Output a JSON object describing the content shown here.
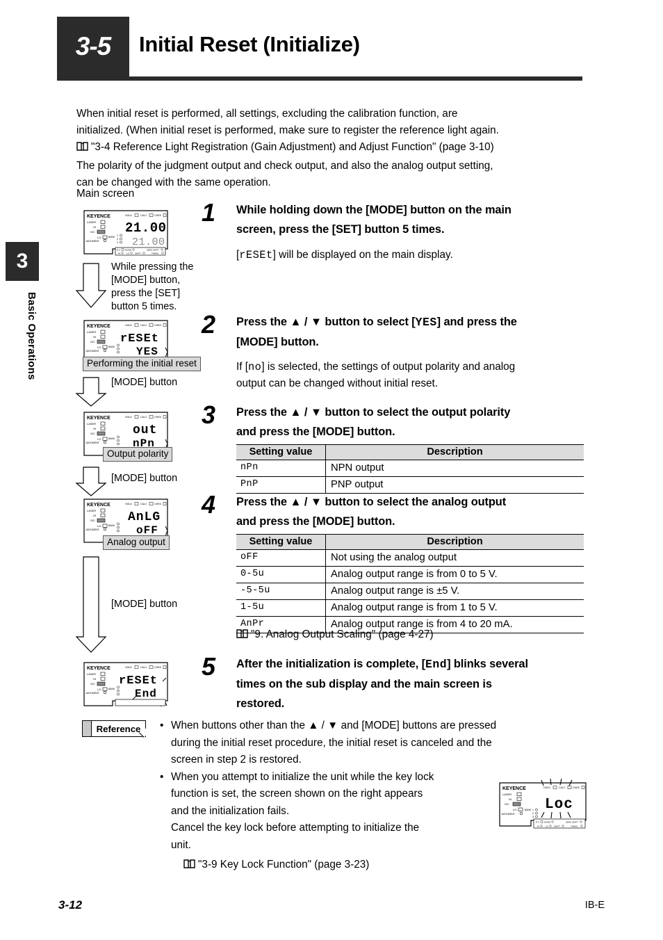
{
  "chapter": {
    "number": "3",
    "label": "Basic Operations"
  },
  "header": {
    "section_number": "3-5",
    "title": "Initial Reset (Initialize)"
  },
  "intro": {
    "line1": "When initial reset is performed, all settings, excluding the calibration function, are",
    "line2": "initialized. (When initial reset is performed, make sure to register the reference light again.",
    "ref_line": "\"3-4 Reference Light Registration (Gain Adjustment) and Adjust Function\" (page 3-10)",
    "line3": "The polarity of the judgment output and check output, and also the analog output setting,",
    "line4": "can be changed with the same operation.",
    "main_screen_label": "Main screen"
  },
  "flow": {
    "device_brand": "KEYENCE",
    "note1_l1": "While pressing the",
    "note1_l2": "[MODE] button,",
    "note1_l3": "press the [SET]",
    "note1_l4": "button 5 times.",
    "mode_button_1": "[MODE] button",
    "mode_button_2": "[MODE] button",
    "mode_button_3": "[MODE] button",
    "callout_reset": "Performing the initial reset",
    "callout_polarity": "Output polarity",
    "callout_analog": "Analog output",
    "display_main_top": "21.00",
    "display_main_bottom": "21.00",
    "display_reset_top": "rESEt",
    "display_reset_bottom": "YES",
    "display_out_top": "out",
    "display_out_bottom": "nPn",
    "display_anlg_top": "AnLG",
    "display_anlg_bottom": "oFF",
    "display_end_top": "rESEt",
    "display_end_bottom": "End",
    "display_loc": "Loc",
    "ind_hold": "HOLD",
    "ind_calc": "CALC",
    "ind_chek": "CHEK",
    "ind_laser": "LASER",
    "ind_hi": "HI",
    "ind_go": "GO",
    "ind_lo": "LO",
    "ind_judgment": "JUDGMENT",
    "ind_bank": "BANK",
    "ind_rv": "R.V",
    "ind_mode": "MODE",
    "ind_shift": "SHIFT",
    "ind_zero_shift": "ZERO SHIFT",
    "ind_timing": "TIMING",
    "ind_set": "SET"
  },
  "steps": [
    {
      "num": "1",
      "head_l1": "While holding down the [MODE] button on the main",
      "head_l2": "screen, press the [SET] button 5 times.",
      "body_pre": "[",
      "body_seg": "rESEt",
      "body_post": "] will be displayed on the main display."
    },
    {
      "num": "2",
      "head_pre": "Press the ▲ / ▼ button to select [",
      "head_seg": "YES",
      "head_post": "] and press the",
      "head_l2": "[MODE] button.",
      "body_pre": "If [",
      "body_seg": "no",
      "body_post": "] is selected, the settings of output polarity and analog",
      "body_l2": "output can be changed without initial reset."
    },
    {
      "num": "3",
      "head_l1": "Press the ▲ / ▼ button to select the output polarity",
      "head_l2": "and press the [MODE] button."
    },
    {
      "num": "4",
      "head_l1": "Press the ▲ / ▼ button to select the analog output",
      "head_l2": "and press the [MODE] button."
    },
    {
      "num": "5",
      "head_pre": "After the initialization is complete, [",
      "head_seg": "End",
      "head_post": "] blinks several",
      "head_l2": "times on the sub display and the main screen is",
      "head_l3": "restored."
    }
  ],
  "table_polarity": {
    "header": [
      "Setting value",
      "Description"
    ],
    "rows": [
      {
        "value": "nPn",
        "description": "NPN output"
      },
      {
        "value": "PnP",
        "description": "PNP output"
      }
    ]
  },
  "table_analog": {
    "header": [
      "Setting value",
      "Description"
    ],
    "rows": [
      {
        "value": "oFF",
        "description": "Not using the analog output"
      },
      {
        "value": "0-5u",
        "description": "Analog output range is from 0 to 5 V."
      },
      {
        "value": "-5-5u",
        "description": "Analog output range is ±5 V."
      },
      {
        "value": "1-5u",
        "description": "Analog output range is from 1 to 5 V."
      },
      {
        "value": "AnPr",
        "description": "Analog output range is from 4 to 20 mA."
      }
    ]
  },
  "seealso_analog": "\"9. Analog Output Scaling\" (page 4-27)",
  "reference": {
    "badge": "Reference",
    "bullet1_l1": "When buttons other than the ▲ / ▼ and [MODE] buttons are pressed",
    "bullet1_l2": "during the initial reset procedure, the initial reset is canceled and the",
    "bullet1_l3": "screen in step 2 is restored.",
    "bullet2_l1": "When you attempt to initialize the unit while the key lock",
    "bullet2_l2": "function is set, the screen shown on the right appears",
    "bullet2_l3": "and the initialization fails.",
    "bullet2_l4": "Cancel the key lock before attempting to initialize the",
    "bullet2_l5": "unit.",
    "seealso": "\"3-9 Key Lock Function\" (page 3-23)"
  },
  "footer": {
    "page": "3-12",
    "doc_code": "IB-E"
  },
  "colors": {
    "dark": "#2b2b2b",
    "table_header": "#dcdcdc",
    "callout": "#d9d9d9"
  }
}
